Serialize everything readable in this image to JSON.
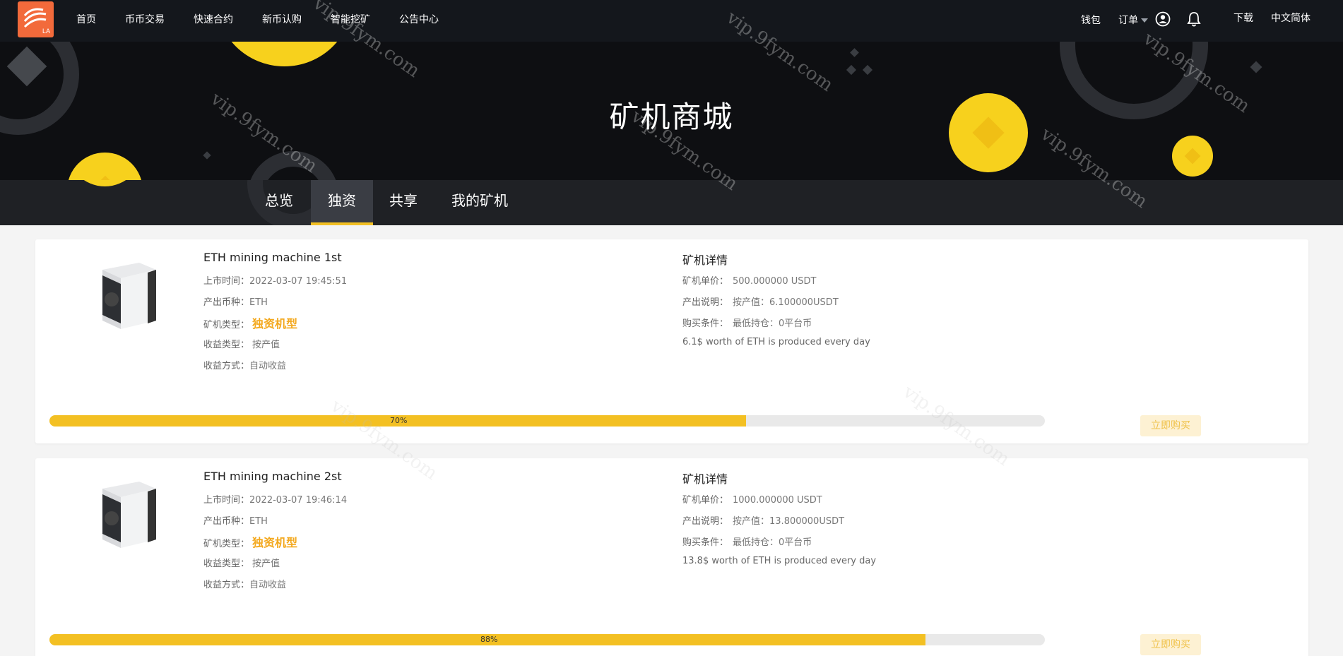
{
  "header": {
    "logo_text": "LA",
    "nav": [
      "首页",
      "币币交易",
      "快速合约",
      "新币认购",
      "智能挖矿",
      "公告中心"
    ],
    "wallet": "钱包",
    "orders": "订单",
    "download": "下载",
    "language": "中文简体"
  },
  "hero": {
    "title": "矿机商城"
  },
  "tabs": [
    "总览",
    "独资",
    "共享",
    "我的矿机"
  ],
  "active_tab": "独资",
  "labels": {
    "listing_time": "上市时间：",
    "coin": "产出币种：",
    "machine_type": "矿机类型：",
    "income_type": "收益类型：",
    "income_method": "收益方式：",
    "details_title": "矿机详情",
    "unit_price": "矿机单价：",
    "output_desc": "产出说明：",
    "buy_condition": "购买条件：",
    "buy_button": "立即购买"
  },
  "machines": [
    {
      "name": "ETH mining machine 1st",
      "listing_time": "2022-03-07 19:45:51",
      "coin": "ETH",
      "type": "独资机型",
      "income_type": "按产值",
      "income_method": "自动收益",
      "unit_price": "500.000000 USDT",
      "output": "按产值：6.100000USDT",
      "condition": "最低持仓：0平台币",
      "daily": "6.1$ worth of ETH is produced every day",
      "progress": 70,
      "progress_label": "70%"
    },
    {
      "name": "ETH mining machine 2st",
      "listing_time": "2022-03-07 19:46:14",
      "coin": "ETH",
      "type": "独资机型",
      "income_type": "按产值",
      "income_method": "自动收益",
      "unit_price": "1000.000000 USDT",
      "output": "按产值：13.800000USDT",
      "condition": "最低持仓：0平台币",
      "daily": "13.8$ worth of ETH is produced every day",
      "progress": 88,
      "progress_label": "88%"
    }
  ],
  "watermark": "vip.9fym.com",
  "colors": {
    "accent": "#f3c023",
    "header_bg": "#14171c",
    "logo_bg": "#f26a3b"
  }
}
